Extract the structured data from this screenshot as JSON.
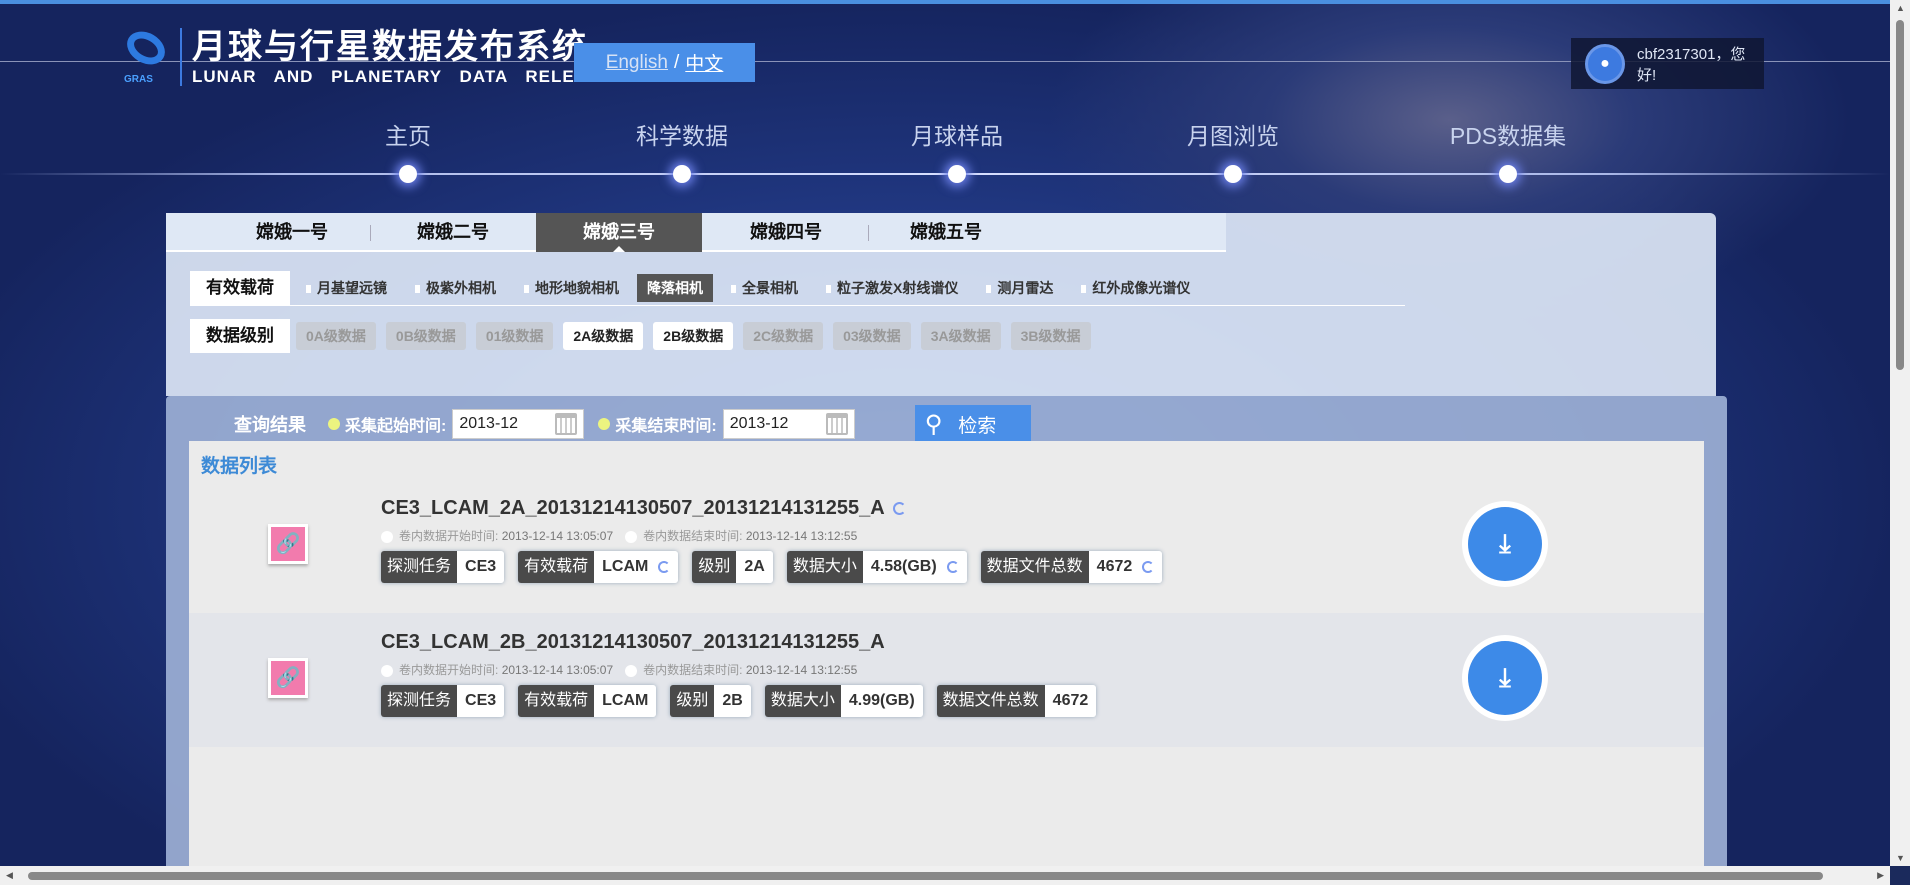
{
  "header": {
    "title_cn": "月球与行星数据发布系统",
    "title_en": "LUNAR AND PLANETARY DATA RELEASE SYSTEM",
    "logo_text": "GRAS",
    "lang_en": "English",
    "lang_sep": "/",
    "lang_cn": "中文",
    "user_greeting": "cbf2317301，您好!"
  },
  "nav": [
    {
      "label": "主页"
    },
    {
      "label": "科学数据"
    },
    {
      "label": "月球样品"
    },
    {
      "label": "月图浏览"
    },
    {
      "label": "PDS数据集"
    }
  ],
  "missions": [
    {
      "label": "嫦娥一号"
    },
    {
      "label": "嫦娥二号"
    },
    {
      "label": "嫦娥三号",
      "active": true
    },
    {
      "label": "嫦娥四号"
    },
    {
      "label": "嫦娥五号"
    }
  ],
  "payload": {
    "label": "有效载荷",
    "items": [
      "月基望远镜",
      "极紫外相机",
      "地形地貌相机",
      "降落相机",
      "全景相机",
      "粒子激发X射线谱仪",
      "测月雷达",
      "红外成像光谱仪"
    ],
    "active": "降落相机"
  },
  "level": {
    "label": "数据级别",
    "items": [
      "0A级数据",
      "0B级数据",
      "01级数据",
      "2A级数据",
      "2B级数据",
      "2C级数据",
      "03级数据",
      "3A级数据",
      "3B级数据"
    ],
    "enabled": [
      "2A级数据",
      "2B级数据"
    ]
  },
  "query": {
    "title": "查询结果",
    "start_label": "采集起始时间:",
    "start_value": "2013-12",
    "end_label": "采集结束时间:",
    "end_value": "2013-12",
    "search_label": "检索"
  },
  "list": {
    "title": "数据列表",
    "items": [
      {
        "name": "CE3_LCAM_2A_20131214130507_20131214131255_A",
        "start_label": "卷内数据开始时间:",
        "start": "2013-12-14 13:05:07",
        "end_label": "卷内数据结束时间:",
        "end": "2013-12-14 13:12:55",
        "tags": [
          {
            "k": "探测任务",
            "v": "CE3"
          },
          {
            "k": "有效载荷",
            "v": "LCAM"
          },
          {
            "k": "级别",
            "v": "2A"
          },
          {
            "k": "数据大小",
            "v": "4.58(GB)"
          },
          {
            "k": "数据文件总数",
            "v": "4672"
          }
        ]
      },
      {
        "name": "CE3_LCAM_2B_20131214130507_20131214131255_A",
        "start_label": "卷内数据开始时间:",
        "start": "2013-12-14 13:05:07",
        "end_label": "卷内数据结束时间:",
        "end": "2013-12-14 13:12:55",
        "tags": [
          {
            "k": "探测任务",
            "v": "CE3"
          },
          {
            "k": "有效载荷",
            "v": "LCAM"
          },
          {
            "k": "级别",
            "v": "2B"
          },
          {
            "k": "数据大小",
            "v": "4.99(GB)"
          },
          {
            "k": "数据文件总数",
            "v": "4672"
          }
        ]
      }
    ]
  },
  "icons": {
    "download": "download-icon",
    "file": "link-file-icon",
    "search": "search-icon",
    "calendar": "calendar-icon",
    "user": "user-avatar-icon"
  }
}
